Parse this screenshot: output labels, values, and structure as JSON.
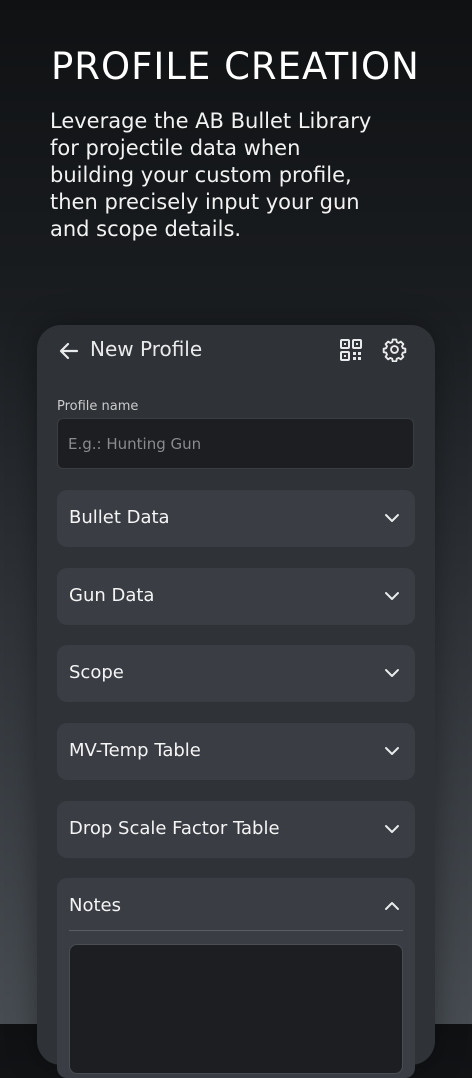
{
  "hero": {
    "title": "PROFILE CREATION",
    "description": "Leverage the AB Bullet Library for projectile data when building your custom profile, then precisely input your gun and scope details."
  },
  "topbar": {
    "title": "New Profile",
    "icons": [
      "back-arrow-icon",
      "qr-code-icon",
      "gear-icon"
    ]
  },
  "profile_name": {
    "label": "Profile name",
    "placeholder": "E.g.: Hunting Gun",
    "value": ""
  },
  "sections": [
    {
      "label": "Bullet Data",
      "expanded": false
    },
    {
      "label": "Gun Data",
      "expanded": false
    },
    {
      "label": "Scope",
      "expanded": false
    },
    {
      "label": "MV-Temp Table",
      "expanded": false
    },
    {
      "label": "Drop Scale Factor Table",
      "expanded": false
    }
  ],
  "notes": {
    "label": "Notes",
    "expanded": true,
    "value": ""
  },
  "colors": {
    "panel": "#2f3237",
    "card": "#3a3e44",
    "input_bg": "#1c1e21",
    "text": "#ffffff"
  }
}
